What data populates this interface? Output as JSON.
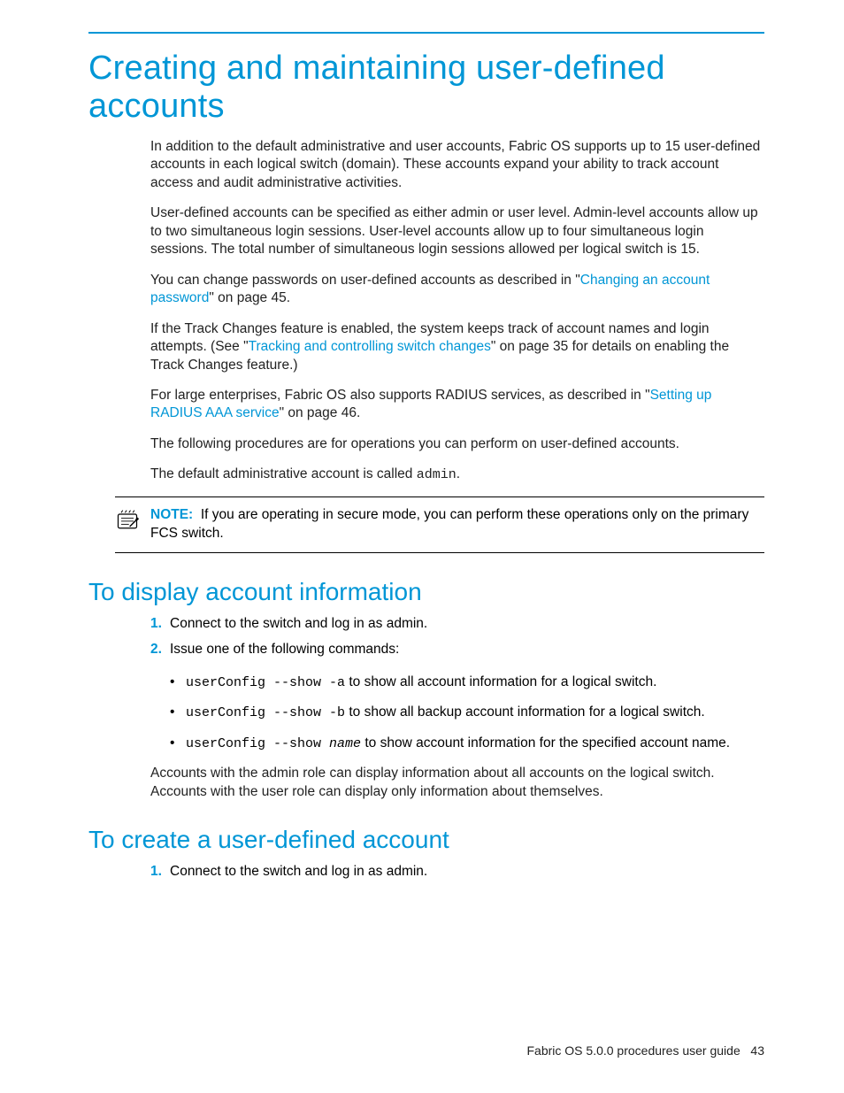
{
  "title": "Creating and maintaining user-defined accounts",
  "intro": {
    "p1": "In addition to the default administrative and user accounts, Fabric OS supports up to 15 user-defined accounts in each logical switch (domain). These accounts expand your ability to track account access and audit administrative activities.",
    "p2": "User-defined accounts can be specified as either admin or user level. Admin-level accounts allow up to two simultaneous login sessions. User-level accounts allow up to four simultaneous login sessions. The total number of simultaneous login sessions allowed per logical switch is 15.",
    "p3a": "You can change passwords on user-defined accounts as described in \"",
    "p3link": "Changing an account password",
    "p3b": "\" on page 45.",
    "p4a": "If the Track Changes feature is enabled, the system keeps track of account names and login attempts. (See \"",
    "p4link": "Tracking and controlling switch changes",
    "p4b": "\" on page 35 for details on enabling the Track Changes feature.)",
    "p5a": "For large enterprises, Fabric OS also supports RADIUS services, as described in \"",
    "p5link": "Setting up RADIUS AAA service",
    "p5b": "\" on page 46.",
    "p6": "The following procedures are for operations you can perform on user-defined accounts.",
    "p7a": "The default administrative account is called ",
    "p7code": "admin",
    "p7b": "."
  },
  "note": {
    "label": "NOTE:",
    "text": "If you are operating in secure mode, you can perform these operations only on the primary FCS switch."
  },
  "section_display": {
    "heading": "To display account information",
    "step1": "Connect to the switch and log in as admin.",
    "step2": "Issue one of the following commands:",
    "bullets": [
      {
        "code": "userConfig --show -a",
        "text": " to show all account information for a logical switch."
      },
      {
        "code": "userConfig --show -b",
        "text": " to show all backup account information for a logical switch."
      },
      {
        "code": "userConfig --show ",
        "arg": "name",
        "text": " to show account information for the specified account name."
      }
    ],
    "para": "Accounts with the admin role can display information about all accounts on the logical switch. Accounts with the user role can display only information about themselves."
  },
  "section_create": {
    "heading": "To create a user-defined account",
    "step1": "Connect to the switch and log in as admin."
  },
  "footer": {
    "text": "Fabric OS 5.0.0 procedures user guide",
    "page": "43"
  }
}
